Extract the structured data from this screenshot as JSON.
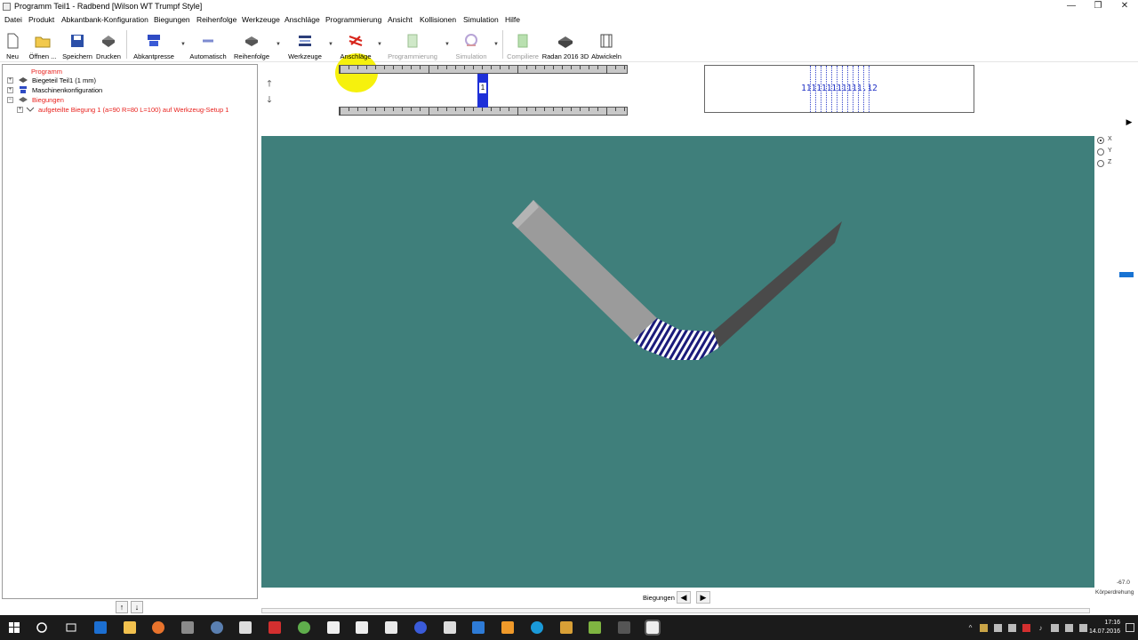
{
  "window": {
    "title": "Programm Teil1 - Radbend [Wilson WT Trumpf Style]",
    "controls": [
      "—",
      "❐",
      "✕"
    ]
  },
  "menu": [
    "Datei",
    "Produkt",
    "Abkantbank-Konfiguration",
    "Biegungen",
    "Reihenfolge",
    "Werkzeuge",
    "Anschläge",
    "Programmierung",
    "Ansicht",
    "Kollisionen",
    "Simulation",
    "Hilfe"
  ],
  "toolbar": {
    "new": "Neu",
    "open": "Öffnen ...",
    "save": "Speichern",
    "print": "Drucken",
    "press": "Abkantpresse",
    "auto": "Automatisch",
    "sequence": "Reihenfolge",
    "tools": "Werkzeuge",
    "stops": "Anschläge",
    "programming": "Programmierung",
    "simulation": "Simulation",
    "compile": "Compiliere",
    "radan3d": "Radan 2016 3D",
    "unfold": "Abwickeln"
  },
  "tree": {
    "root": "Programm",
    "part": "Biegeteil Teil1 (1 mm)",
    "machine": "Maschinenkonfiguration",
    "bends": "Biegungen",
    "bend1": "aufgeteilte Biegung 1 (a=90 R=80 L=100) auf Werkzeug-Setup 1"
  },
  "marker": {
    "number": "1"
  },
  "info": {
    "code": "111111111111.12"
  },
  "axes": [
    "X",
    "Y",
    "Z"
  ],
  "selected_axis": "X",
  "rotation": {
    "value": "-67.0",
    "label": "Körperdrehung"
  },
  "bottom": {
    "label": "Biegungen"
  },
  "clock": {
    "time": "17:16",
    "date": "14.07.2016"
  },
  "colors": {
    "viewport": "#3f7f7b",
    "accent": "#1873d3",
    "tree_highlight": "#e8221e"
  }
}
